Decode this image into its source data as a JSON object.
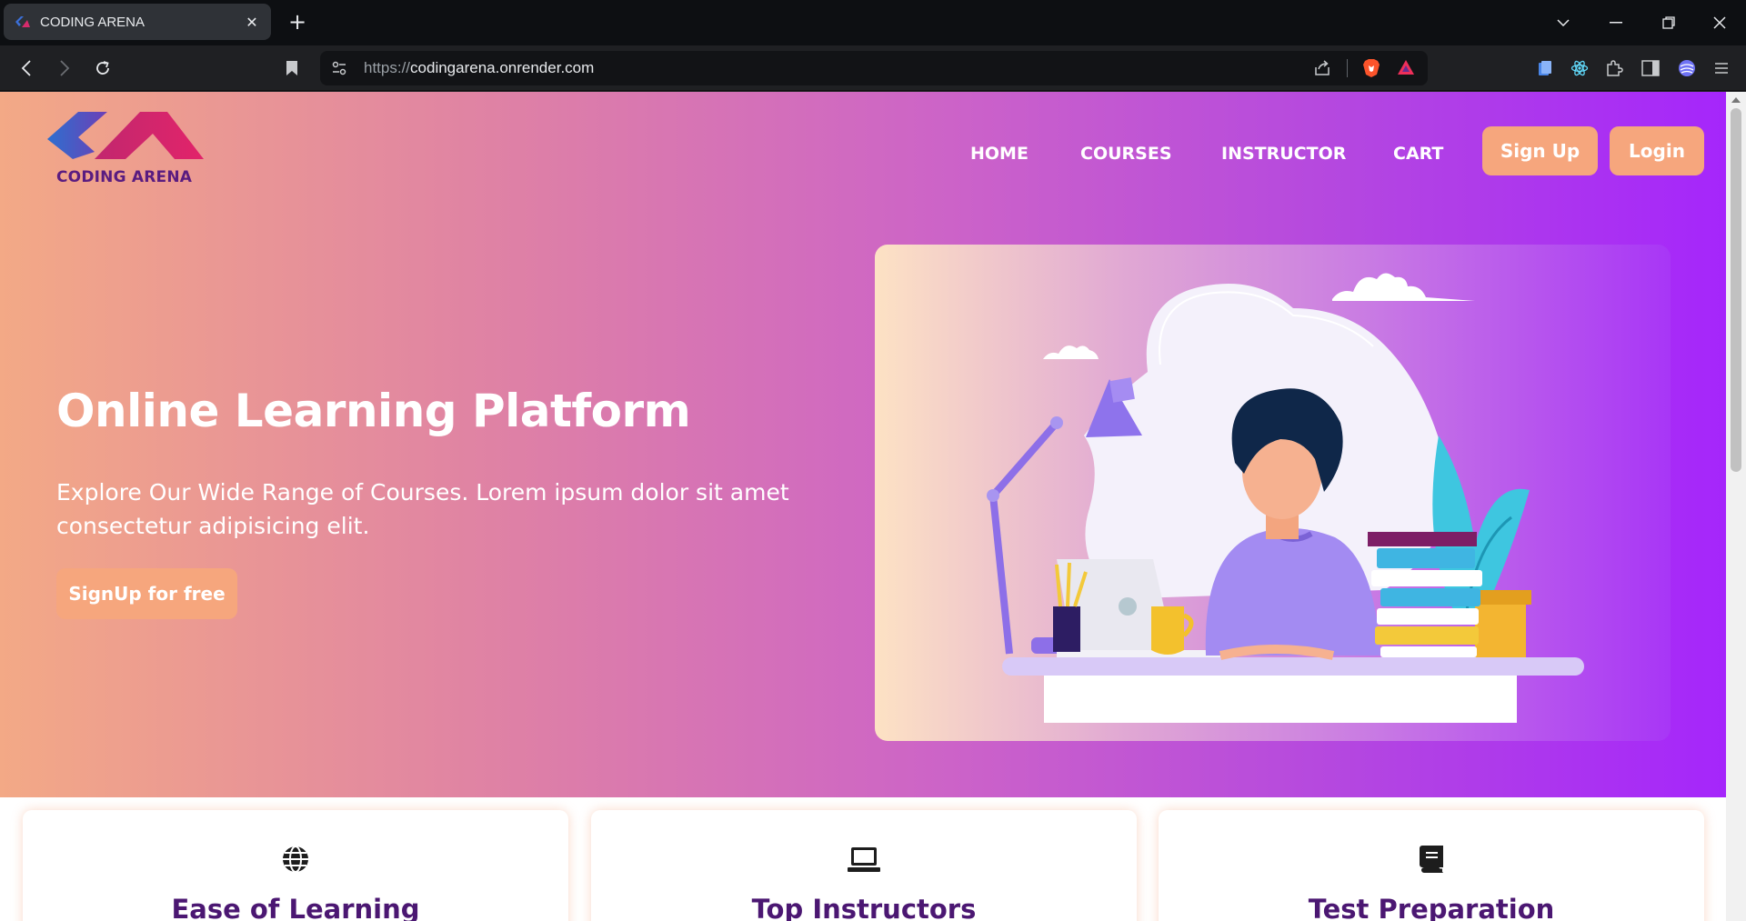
{
  "browser": {
    "tab_title": "CODING ARENA",
    "tab_close": "✕",
    "new_tab": "+",
    "url_protocol": "https://",
    "url_host": "codingarena.onrender.com"
  },
  "header": {
    "logo_text": "CODING ARENA",
    "nav": [
      "HOME",
      "COURSES",
      "INSTRUCTOR",
      "CART"
    ],
    "signup_label": "Sign Up",
    "login_label": "Login"
  },
  "hero": {
    "title": "Online Learning Platform",
    "description": "Explore Our Wide Range of Courses. Lorem ipsum dolor sit amet consectetur adipisicing elit.",
    "cta_label": "SignUp for free"
  },
  "features": [
    {
      "title": "Ease of Learning",
      "icon": "globe-icon"
    },
    {
      "title": "Top Instructors",
      "icon": "laptop-icon"
    },
    {
      "title": "Test Preparation",
      "icon": "book-icon"
    }
  ],
  "colors": {
    "hero_gradient_start": "#f3a986",
    "hero_gradient_end": "#a526fb",
    "button_orange": "#f6a67d",
    "heading_purple": "#4b1772"
  }
}
